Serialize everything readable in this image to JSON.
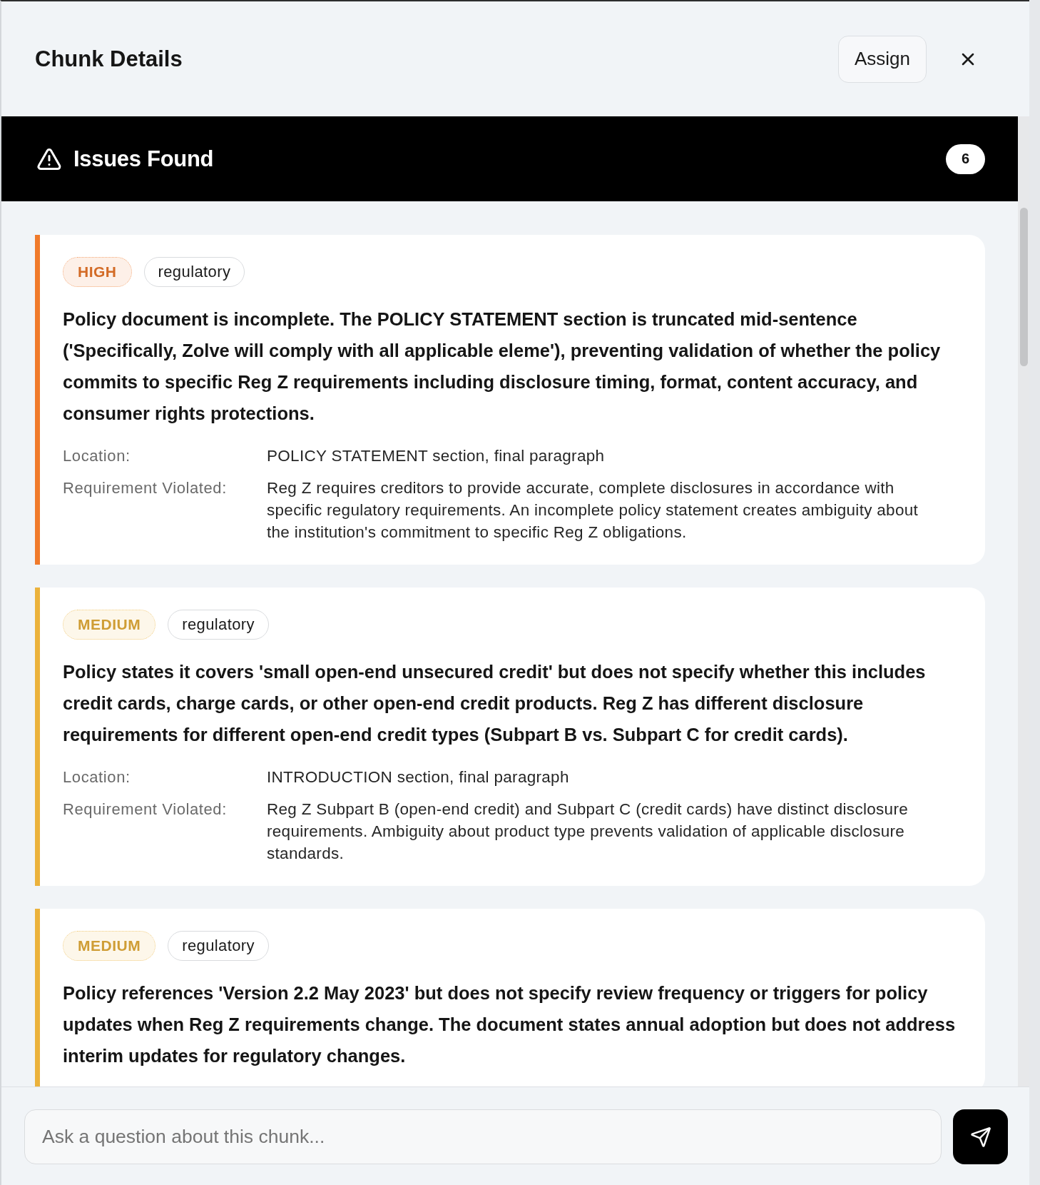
{
  "panel": {
    "title": "Chunk Details",
    "assign_button": "Assign"
  },
  "issues_banner": {
    "title": "Issues Found",
    "count": "6"
  },
  "issues": [
    {
      "severity": "HIGH",
      "color": "#f07a2b",
      "category": "regulatory",
      "description": "Policy document is incomplete. The POLICY STATEMENT section is truncated mid-sentence ('Specifically, Zolve will comply with all applicable eleme'), preventing validation of whether the policy commits to specific Reg Z requirements including disclosure timing, format, content accuracy, and consumer rights protections.",
      "details": [
        {
          "label": "Location:",
          "value": "POLICY STATEMENT section, final paragraph"
        },
        {
          "label": "Requirement Violated:",
          "value": "Reg Z requires creditors to provide accurate, complete disclosures in accordance with specific regulatory requirements. An incomplete policy statement creates ambiguity about the institution's commitment to specific Reg Z obligations."
        }
      ]
    },
    {
      "severity": "MEDIUM",
      "color": "#ebb23c",
      "category": "regulatory",
      "description": "Policy states it covers 'small open-end unsecured credit' but does not specify whether this includes credit cards, charge cards, or other open-end credit products. Reg Z has different disclosure requirements for different open-end credit types (Subpart B vs. Subpart C for credit cards).",
      "details": [
        {
          "label": "Location:",
          "value": "INTRODUCTION section, final paragraph"
        },
        {
          "label": "Requirement Violated:",
          "value": "Reg Z Subpart B (open-end credit) and Subpart C (credit cards) have distinct disclosure requirements. Ambiguity about product type prevents validation of applicable disclosure standards."
        }
      ]
    },
    {
      "severity": "MEDIUM",
      "color": "#ebb23c",
      "category": "regulatory",
      "description": "Policy references 'Version 2.2 May 2023' but does not specify review frequency or triggers for policy updates when Reg Z requirements change. The document states annual adoption but does not address interim updates for regulatory changes."
    }
  ],
  "chat": {
    "placeholder": "Ask a question about this chunk..."
  }
}
